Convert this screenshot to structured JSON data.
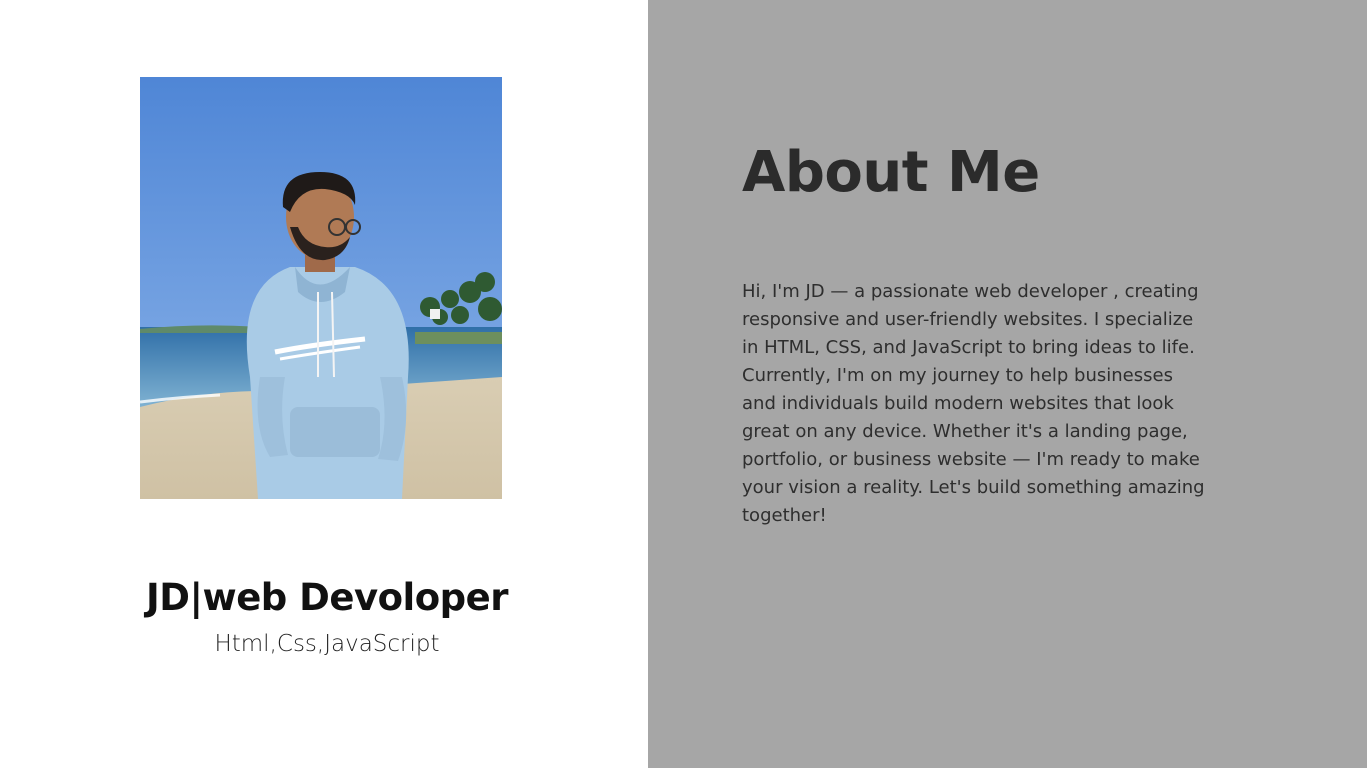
{
  "profile": {
    "photo_alt": "Photo of JD on the beach",
    "name": "JD|web Devoloper",
    "skills": "Html,Css,JavaScript"
  },
  "about": {
    "title": "About Me",
    "body": "Hi, I'm JD — a passionate web developer , creating responsive and user-friendly websites. I specialize in HTML, CSS, and JavaScript to bring ideas to life. Currently, I'm on my journey to help businesses and individuals build modern websites that look great on any device. Whether it's a landing page, portfolio, or business website — I'm ready to make your vision a reality. Let's build something amazing together!"
  },
  "colors": {
    "left_bg": "#ffffff",
    "right_bg": "#a6a6a6",
    "heading": "#2b2b2b",
    "text": "#2e2e2e"
  }
}
